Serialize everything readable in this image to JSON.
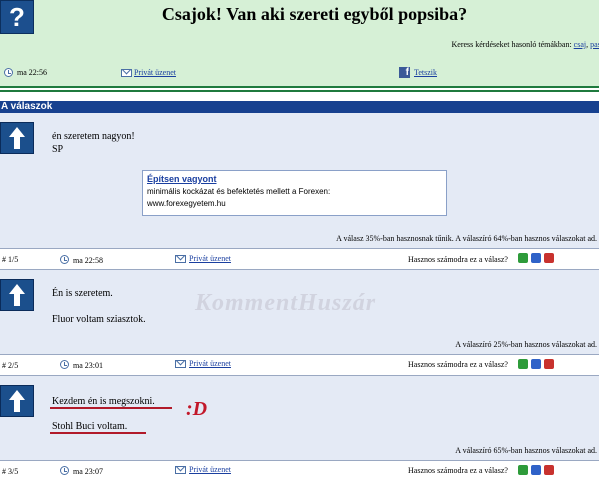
{
  "question": {
    "title": "Csajok! Van aki szereti egyből popsiba?",
    "icon": "question-mark-icon",
    "related_label": "Keress kérdéseket hasonló témákban:",
    "related_tags": [
      "csaj",
      "pasi"
    ],
    "time": "ma 22:56",
    "private_msg": "Privát üzenet",
    "like": "Tetszik"
  },
  "answers_header": "A válaszok",
  "ad": {
    "title": "Építsen vagyont",
    "line1": "minimális kockázat és befektetés mellett a Forexen:",
    "line2": "www.forexegyetem.hu"
  },
  "answers": [
    {
      "lines": [
        "én szeretem nagyon!",
        "SP"
      ],
      "rating": "A válasz 35%-ban hasznosnak tűnik. A válaszíró 64%-ban hasznos válaszokat ad.",
      "index": "# 1/5",
      "time": "ma 22:58",
      "private_msg": "Privát üzenet",
      "useful_q": "Hasznos számodra ez a válasz?"
    },
    {
      "lines": [
        "Én is szeretem.",
        "Fluor voltam sziasztok."
      ],
      "rating": "A válaszíró 25%-ban hasznos válaszokat ad.",
      "index": "# 2/5",
      "time": "ma 23:01",
      "private_msg": "Privát üzenet",
      "useful_q": "Hasznos számodra ez a válasz?"
    },
    {
      "lines": [
        "Kezdem én is megszokni.",
        "Stohl Buci voltam."
      ],
      "rating": "A válaszíró 65%-ban hasznos válaszokat ad.",
      "index": "# 3/5",
      "time": "ma 23:07",
      "private_msg": "Privát üzenet",
      "useful_q": "Hasznos számodra ez a válasz?"
    }
  ],
  "annotation": ":D",
  "watermark": "KommentHuszár",
  "colors": {
    "header_bg": "#d6f0d6",
    "answers_bar": "#17418f",
    "panel_bg": "#e4eaf5",
    "thumb_up": "#2e9b3a",
    "thumb_mid": "#2f62c8",
    "thumb_down": "#c8322e",
    "annotation": "#c2182a"
  }
}
